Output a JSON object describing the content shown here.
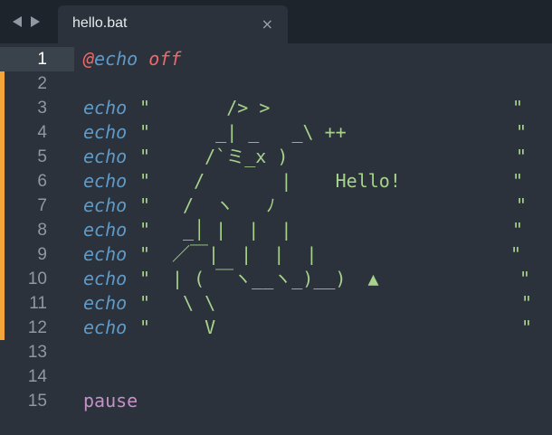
{
  "tab": {
    "title": "hello.bat",
    "close_glyph": "×"
  },
  "icons": {
    "back": "chevron-left-icon",
    "forward": "chevron-right-icon",
    "close": "close-icon"
  },
  "colors": {
    "background": "#2b323b",
    "gutter_current": "#3a424b",
    "modified_marker": "#f3a53a",
    "keyword_echo": "#5f9ac8",
    "keyword_at_off": "#ee6a6a",
    "string": "#a6d28c",
    "keyword_pause": "#c590c8"
  },
  "lines": [
    {
      "n": "1",
      "parts": [
        "@",
        "echo",
        " off"
      ]
    },
    {
      "n": "2"
    },
    {
      "n": "3",
      "cmd": "echo",
      "open": "\"",
      "text": "     /> >",
      "close": "\""
    },
    {
      "n": "4",
      "cmd": "echo",
      "open": "\"",
      "text": "    _| _   _\\ ++",
      "close": "\""
    },
    {
      "n": "5",
      "cmd": "echo",
      "open": "\"",
      "text": "   /`ミ_x )",
      "close": "\""
    },
    {
      "n": "6",
      "cmd": "echo",
      "open": "\"",
      "text": "  /       |    Hello!",
      "close": "\""
    },
    {
      "n": "7",
      "cmd": "echo",
      "open": "\"",
      "text": " /  ヽ   ﾉ",
      "close": "\""
    },
    {
      "n": "8",
      "cmd": "echo",
      "open": "\"",
      "text": " _│ |  |  |",
      "close": "\""
    },
    {
      "n": "9",
      "cmd": "echo",
      "open": "\"",
      "text": "／￣|  |  |  |",
      "close": "\""
    },
    {
      "n": "10",
      "cmd": "echo",
      "open": "\"",
      "text": "| ( ￣ヽ__ヽ_)__)  ▲",
      "close": "\""
    },
    {
      "n": "11",
      "cmd": "echo",
      "open": "\"",
      "text": " \\ \\",
      "close": "\""
    },
    {
      "n": "12",
      "cmd": "echo",
      "open": "\"",
      "text": "   V",
      "close": "\""
    },
    {
      "n": "13"
    },
    {
      "n": "14"
    },
    {
      "n": "15",
      "pause": "pause"
    }
  ]
}
